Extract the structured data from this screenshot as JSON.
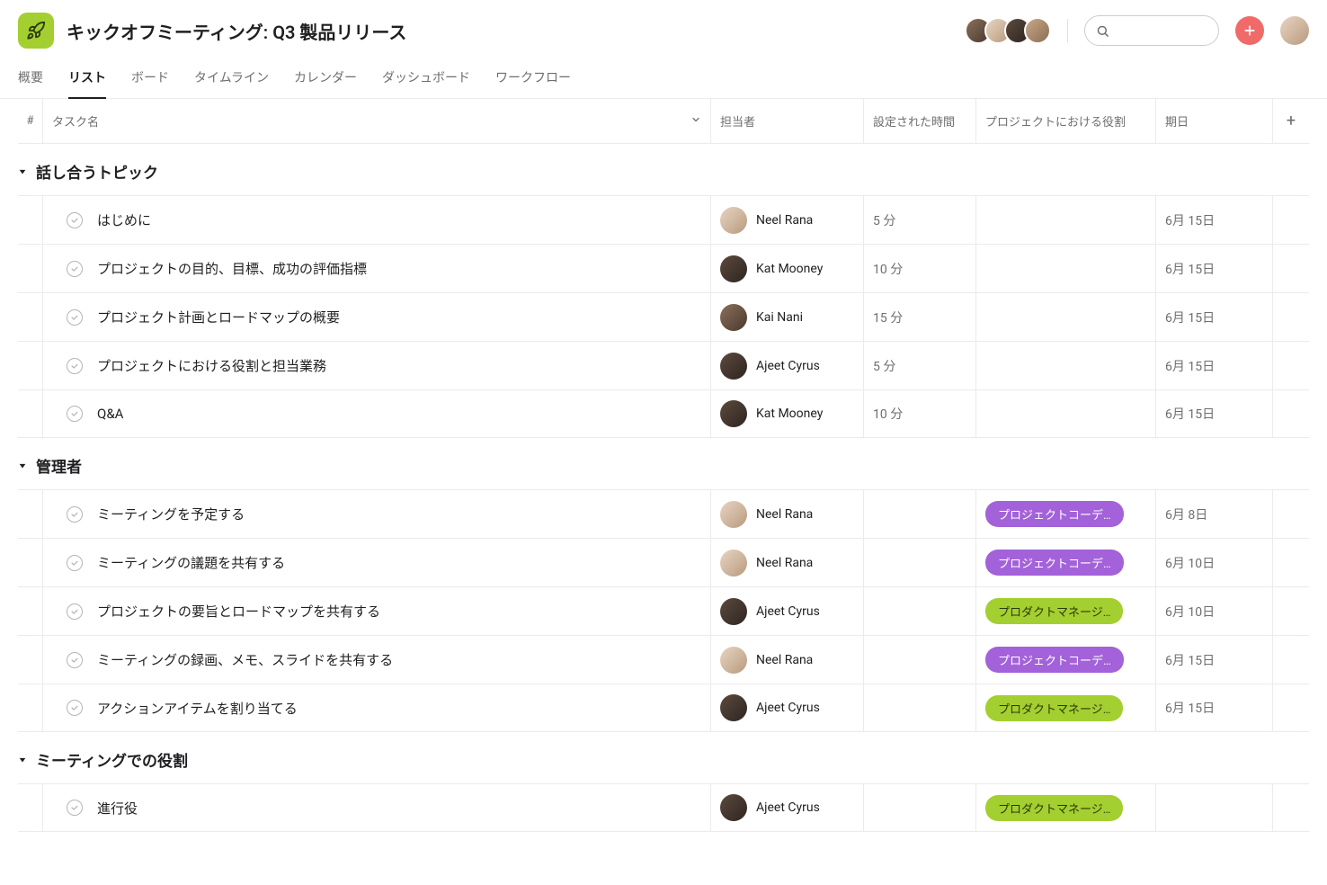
{
  "header": {
    "title": "キックオフミーティング: Q3 製品リリース"
  },
  "tabs": [
    {
      "label": "概要"
    },
    {
      "label": "リスト",
      "active": true
    },
    {
      "label": "ボード"
    },
    {
      "label": "タイムライン"
    },
    {
      "label": "カレンダー"
    },
    {
      "label": "ダッシュボード"
    },
    {
      "label": "ワークフロー"
    }
  ],
  "columns": {
    "num": "#",
    "task_name": "タスク名",
    "assignee": "担当者",
    "time": "設定された時間",
    "role": "プロジェクトにおける役割",
    "date": "期日",
    "add": "+"
  },
  "sections": [
    {
      "title": "話し合うトピック",
      "tasks": [
        {
          "name": "はじめに",
          "assignee": "Neel Rana",
          "avatar": "av-2",
          "time": "5 分",
          "role": null,
          "date": "6月 15日"
        },
        {
          "name": "プロジェクトの目的、目標、成功の評価指標",
          "assignee": "Kat Mooney",
          "avatar": "av-3",
          "time": "10 分",
          "role": null,
          "date": "6月 15日"
        },
        {
          "name": "プロジェクト計画とロードマップの概要",
          "assignee": "Kai Nani",
          "avatar": "av-1",
          "time": "15 分",
          "role": null,
          "date": "6月 15日"
        },
        {
          "name": "プロジェクトにおける役割と担当業務",
          "assignee": "Ajeet Cyrus",
          "avatar": "av-3",
          "time": "5 分",
          "role": null,
          "date": "6月 15日"
        },
        {
          "name": "Q&A",
          "assignee": "Kat Mooney",
          "avatar": "av-3",
          "time": "10 分",
          "role": null,
          "date": "6月 15日"
        }
      ]
    },
    {
      "title": "管理者",
      "tasks": [
        {
          "name": "ミーティングを予定する",
          "assignee": "Neel Rana",
          "avatar": "av-2",
          "time": "",
          "role": "プロジェクトコーデ…",
          "role_color": "purple",
          "date": "6月 8日"
        },
        {
          "name": "ミーティングの議題を共有する",
          "assignee": "Neel Rana",
          "avatar": "av-2",
          "time": "",
          "role": "プロジェクトコーデ…",
          "role_color": "purple",
          "date": "6月 10日"
        },
        {
          "name": "プロジェクトの要旨とロードマップを共有する",
          "assignee": "Ajeet Cyrus",
          "avatar": "av-3",
          "time": "",
          "role": "プロダクトマネージ…",
          "role_color": "green",
          "date": "6月 10日"
        },
        {
          "name": "ミーティングの録画、メモ、スライドを共有する",
          "assignee": "Neel Rana",
          "avatar": "av-2",
          "time": "",
          "role": "プロジェクトコーデ…",
          "role_color": "purple",
          "date": "6月 15日"
        },
        {
          "name": "アクションアイテムを割り当てる",
          "assignee": "Ajeet Cyrus",
          "avatar": "av-3",
          "time": "",
          "role": "プロダクトマネージ…",
          "role_color": "green",
          "date": "6月 15日"
        }
      ]
    },
    {
      "title": "ミーティングでの役割",
      "tasks": [
        {
          "name": "進行役",
          "assignee": "Ajeet Cyrus",
          "avatar": "av-3",
          "time": "",
          "role": "プロダクトマネージ…",
          "role_color": "green",
          "date": ""
        }
      ]
    }
  ]
}
